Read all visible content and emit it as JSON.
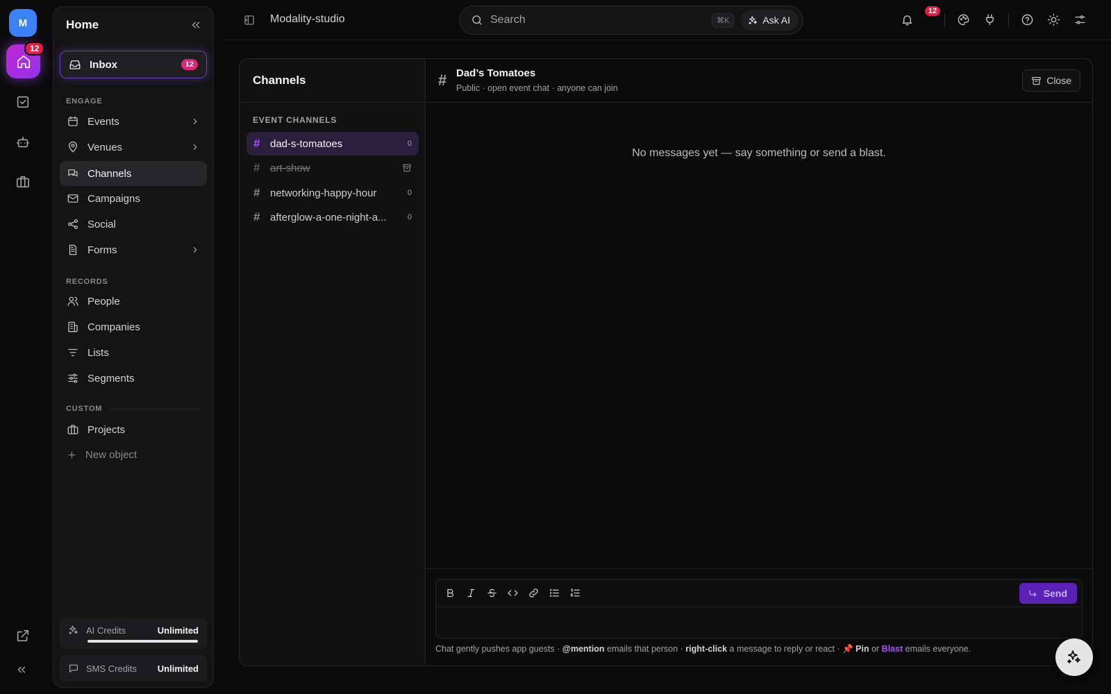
{
  "rail": {
    "avatar_letter": "M",
    "home_badge": "12"
  },
  "sidebar": {
    "title": "Home",
    "inbox": {
      "label": "Inbox",
      "count": "12"
    },
    "sections": {
      "engage": "ENGAGE",
      "records": "RECORDS",
      "custom": "CUSTOM"
    },
    "engage_items": [
      {
        "label": "Events",
        "icon": "calendar-icon",
        "has_chevron": true
      },
      {
        "label": "Venues",
        "icon": "map-pin-icon",
        "has_chevron": true
      },
      {
        "label": "Channels",
        "icon": "chat-icon",
        "active": true
      },
      {
        "label": "Campaigns",
        "icon": "mail-icon"
      },
      {
        "label": "Social",
        "icon": "share-icon"
      },
      {
        "label": "Forms",
        "icon": "document-icon",
        "has_chevron": true
      }
    ],
    "records_items": [
      {
        "label": "People",
        "icon": "users-icon"
      },
      {
        "label": "Companies",
        "icon": "building-icon"
      },
      {
        "label": "Lists",
        "icon": "list-icon"
      },
      {
        "label": "Segments",
        "icon": "sliders-icon"
      }
    ],
    "custom_items": [
      {
        "label": "Projects",
        "icon": "briefcase-icon"
      },
      {
        "label": "New object",
        "icon": "plus-icon"
      }
    ],
    "credits": [
      {
        "label": "AI Credits",
        "value": "Unlimited",
        "level": 1.0
      },
      {
        "label": "SMS Credits",
        "value": "Unlimited"
      }
    ]
  },
  "topbar": {
    "workspace": "Modality-studio",
    "search_placeholder": "Search",
    "search_shortcut": "⌘K",
    "ask_ai_label": "Ask AI",
    "notifications_count": "12"
  },
  "channels": {
    "title": "Channels",
    "section_label": "EVENT CHANNELS",
    "items": [
      {
        "name": "dad-s-tomatoes",
        "count": "0",
        "active": true
      },
      {
        "name": "art-show",
        "archived": true
      },
      {
        "name": "networking-happy-hour",
        "count": "0"
      },
      {
        "name": "afterglow-a-one-night-a...",
        "count": "0"
      }
    ]
  },
  "conversation": {
    "channel_name": "Dad’s Tomatoes",
    "channel_subtitle": "Public · open event chat · anyone can join",
    "close_label": "Close",
    "empty_message": "No messages yet — say something or send a blast.",
    "send_label": "Send",
    "hint": {
      "p1": "Chat gently pushes app guests · ",
      "mention": "@mention",
      "p2": " emails that person · ",
      "right_click": "right-click",
      "p3": " a message to reply or react · ",
      "pin_emoji": "📌",
      "pin": "Pin",
      "p4": " or ",
      "blast": "Blast",
      "p5": " emails everyone."
    }
  },
  "colors": {
    "accent": "#a855f7",
    "badge": "#e11d48",
    "send_button": "#5b21b6"
  }
}
